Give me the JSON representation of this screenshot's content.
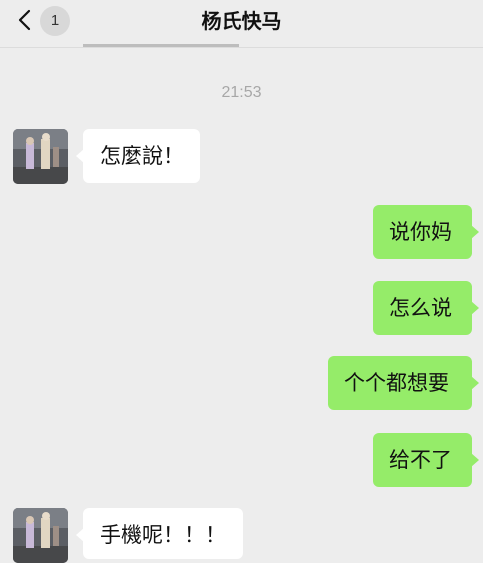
{
  "header": {
    "title": "杨氏快马",
    "unread_count": "1",
    "back_icon": "chevron-left-icon"
  },
  "chat": {
    "timestamp": "21:53",
    "messages": [
      {
        "side": "received",
        "text": "怎麼說！"
      },
      {
        "side": "sent",
        "text": "说你妈"
      },
      {
        "side": "sent",
        "text": "怎么说"
      },
      {
        "side": "sent",
        "text": "个个都想要"
      },
      {
        "side": "sent",
        "text": "给不了"
      },
      {
        "side": "received",
        "text": "手機呢！！！"
      }
    ]
  },
  "colors": {
    "background": "#ededed",
    "received_bubble": "#ffffff",
    "sent_bubble": "#95ec69",
    "timestamp_text": "#a7a7a7"
  }
}
